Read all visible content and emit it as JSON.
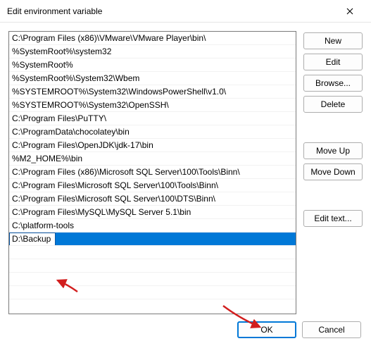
{
  "window": {
    "title": "Edit environment variable"
  },
  "list": {
    "items": [
      "C:\\Program Files (x86)\\VMware\\VMware Player\\bin\\",
      "%SystemRoot%\\system32",
      "%SystemRoot%",
      "%SystemRoot%\\System32\\Wbem",
      "%SYSTEMROOT%\\System32\\WindowsPowerShell\\v1.0\\",
      "%SYSTEMROOT%\\System32\\OpenSSH\\",
      "C:\\Program Files\\PuTTY\\",
      "C:\\ProgramData\\chocolatey\\bin",
      "C:\\Program Files\\OpenJDK\\jdk-17\\bin",
      "%M2_HOME%\\bin",
      "C:\\Program Files (x86)\\Microsoft SQL Server\\100\\Tools\\Binn\\",
      "C:\\Program Files\\Microsoft SQL Server\\100\\Tools\\Binn\\",
      "C:\\Program Files\\Microsoft SQL Server\\100\\DTS\\Binn\\",
      "C:\\Program Files\\MySQL\\MySQL Server 5.1\\bin",
      "C:\\platform-tools"
    ],
    "editing_value": "D:\\Backup"
  },
  "buttons": {
    "new": "New",
    "edit": "Edit",
    "browse": "Browse...",
    "delete": "Delete",
    "move_up": "Move Up",
    "move_down": "Move Down",
    "edit_text": "Edit text...",
    "ok": "OK",
    "cancel": "Cancel"
  },
  "annotation_color": "#d21e1e"
}
